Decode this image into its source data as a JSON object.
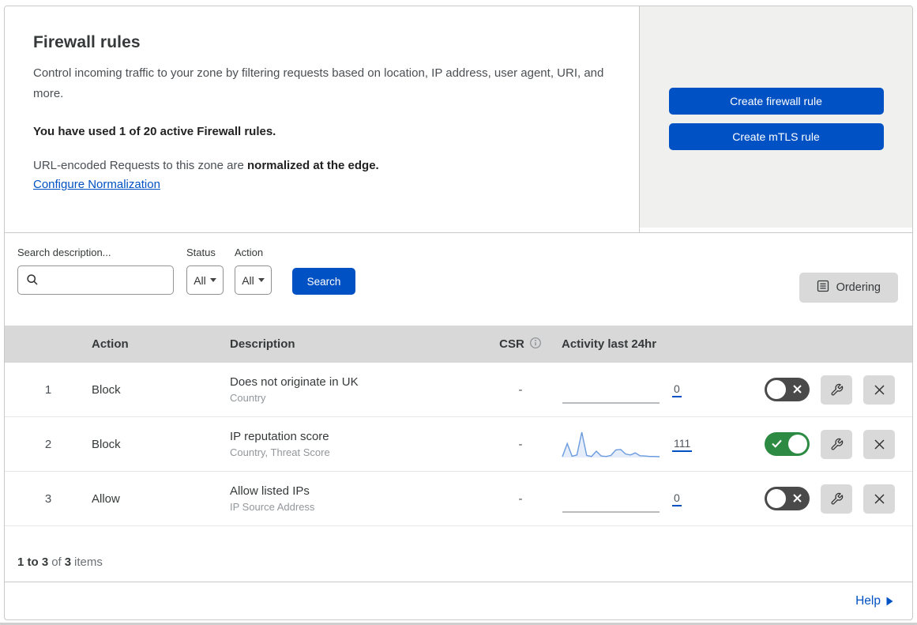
{
  "colors": {
    "accent_blue": "#0051c3",
    "toggle_on_green": "#2c8a43",
    "toggle_off_gray": "#4a4a4a",
    "header_band": "#d8d8d8",
    "panel_gray": "#f0f0ef",
    "icon_button_bg": "#d9d9d9",
    "sparkline_blue": "#6b9bde"
  },
  "icons": {
    "search_icon": "magnifier",
    "dropdown_caret_icon": "down-triangle",
    "ordering_icon": "list-document",
    "csr_info_icon": "info-circle",
    "wrench_icon": "wrench",
    "delete_icon": "x-cross",
    "toggle_off_icon": "x-cross",
    "toggle_on_icon": "checkmark",
    "help_arrow_icon": "right-triangle"
  },
  "intro": {
    "title": "Firewall rules",
    "description": "Control incoming traffic to your zone by filtering requests based on location, IP address, user agent, URI, and more.",
    "usage_note": "You have used 1 of 20 active Firewall rules.",
    "normalization_text": "URL-encoded Requests to this zone are",
    "normalization_emphasis": "normalized at the edge.",
    "normalization_link": "Configure Normalization"
  },
  "cta": {
    "create_firewall_rule": "Create firewall rule",
    "create_mtls_rule": "Create mTLS rule"
  },
  "filters": {
    "search_label": "Search description...",
    "status_label": "Status",
    "status_value": "All",
    "action_label": "Action",
    "action_value": "All",
    "search_button": "Search",
    "ordering_button": "Ordering"
  },
  "table": {
    "headers": {
      "action": "Action",
      "description": "Description",
      "csr": "CSR",
      "activity": "Activity last 24hr"
    },
    "rows": [
      {
        "priority": "1",
        "action": "Block",
        "title": "Does not originate in UK",
        "subtitle": "Country",
        "csr": "-",
        "count": "0",
        "enabled": false,
        "activity_series": []
      },
      {
        "priority": "2",
        "action": "Block",
        "title": "IP reputation score",
        "subtitle": "Country, Threat Score",
        "csr": "-",
        "count": "111",
        "enabled": true,
        "activity_series": [
          3,
          55,
          5,
          10,
          100,
          8,
          4,
          25,
          6,
          4,
          8,
          30,
          32,
          14,
          10,
          18,
          7,
          6,
          4,
          4,
          3
        ]
      },
      {
        "priority": "3",
        "action": "Allow",
        "title": "Allow listed IPs",
        "subtitle": "IP Source Address",
        "csr": "-",
        "count": "0",
        "enabled": false,
        "activity_series": []
      }
    ]
  },
  "footer": {
    "range": "1 to 3",
    "of": "of",
    "total": "3",
    "items_label": "items"
  },
  "help": {
    "label": "Help"
  }
}
